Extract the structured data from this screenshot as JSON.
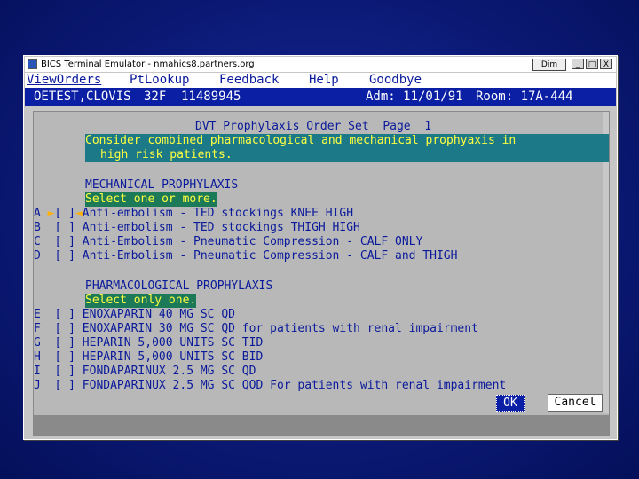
{
  "window": {
    "title": "BICS Terminal Emulator - nmahics8.partners.org",
    "dim_label": "Dim",
    "controls": [
      "_",
      "□",
      "X"
    ]
  },
  "menu": [
    "ViewOrders",
    "PtLookup",
    "Feedback",
    "Help",
    "Goodbye"
  ],
  "patient": {
    "name": "OETEST,CLOVIS",
    "age_sex": "32F",
    "mrn": "11489945",
    "admission": "Adm: 11/01/91",
    "room": "Room: 17A-444"
  },
  "order_set": {
    "title": "DVT Prophylaxis Order Set",
    "page": "Page  1",
    "banner_line1": "Consider combined pharmacological and mechanical prophyaxis in",
    "banner_line2": "high risk patients.",
    "mechanical": {
      "header": "MECHANICAL PROPHYLAXIS",
      "instruction": "Select one or more.",
      "items": [
        {
          "letter": "A",
          "checkbox": "[ ]",
          "text": "Anti-embolism - TED stockings KNEE HIGH"
        },
        {
          "letter": "B",
          "checkbox": "[ ]",
          "text": "Anti-embolism - TED stockings THIGH HIGH"
        },
        {
          "letter": "C",
          "checkbox": "[ ]",
          "text": "Anti-Embolism - Pneumatic Compression - CALF ONLY"
        },
        {
          "letter": "D",
          "checkbox": "[ ]",
          "text": "Anti-Embolism - Pneumatic Compression - CALF and THIGH"
        }
      ]
    },
    "pharmacological": {
      "header": "PHARMACOLOGICAL PROPHYLAXIS",
      "instruction": "Select only one.",
      "items": [
        {
          "letter": "E",
          "checkbox": "[ ]",
          "text": "ENOXAPARIN 40 MG SC QD"
        },
        {
          "letter": "F",
          "checkbox": "[ ]",
          "text": "ENOXAPARIN 30 MG SC QD for patients with renal impairment"
        },
        {
          "letter": "G",
          "checkbox": "[ ]",
          "text": "HEPARIN 5,000 UNITS SC TID"
        },
        {
          "letter": "H",
          "checkbox": "[ ]",
          "text": "HEPARIN 5,000 UNITS SC BID"
        },
        {
          "letter": "I",
          "checkbox": "[ ]",
          "text": "FONDAPARINUX 2.5 MG SC QD"
        },
        {
          "letter": "J",
          "checkbox": "[ ]",
          "text": "FONDAPARINUX 2.5 MG SC QOD For patients with renal impairment"
        }
      ]
    }
  },
  "buttons": {
    "ok": "OK",
    "cancel": "Cancel"
  }
}
